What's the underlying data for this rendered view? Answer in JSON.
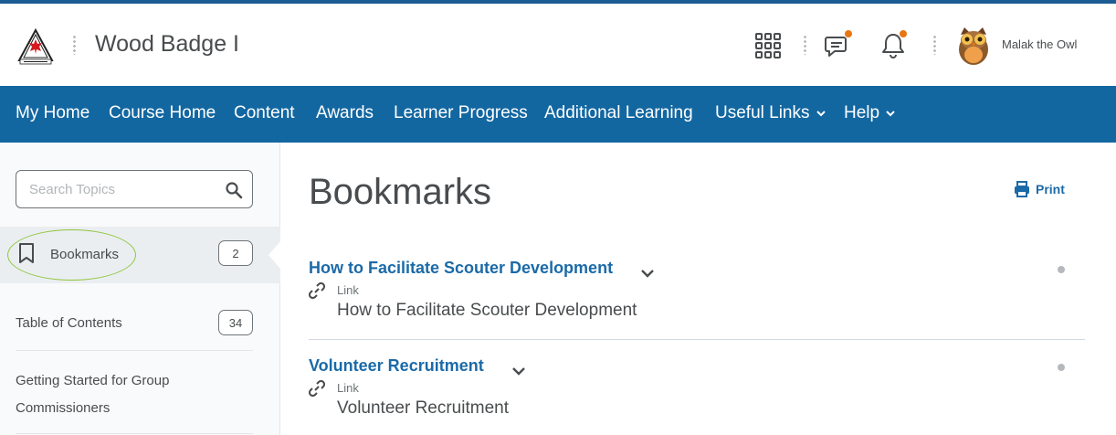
{
  "header": {
    "logo_name": "scouts-canada-logo",
    "course_title": "Wood Badge I",
    "user_name": "Malak the Owl",
    "accent_color": "#1367a1",
    "notification_color": "#e87511"
  },
  "nav": {
    "items": [
      {
        "label": "My Home"
      },
      {
        "label": "Course Home"
      },
      {
        "label": "Content"
      },
      {
        "label": "Awards"
      },
      {
        "label": "Learner Progress"
      },
      {
        "label": "Additional Learning"
      },
      {
        "label": "Useful Links",
        "dropdown": true
      },
      {
        "label": "Help",
        "dropdown": true
      }
    ]
  },
  "sidebar": {
    "search_placeholder": "Search Topics",
    "bookmarks": {
      "label": "Bookmarks",
      "count": "2"
    },
    "toc": {
      "label": "Table of Contents",
      "count": "34"
    },
    "module": {
      "label": "Getting Started for Group Commissioners"
    }
  },
  "main": {
    "title": "Bookmarks",
    "print_label": "Print",
    "topics": [
      {
        "title": "How to Facilitate Scouter Development",
        "type": "Link",
        "subtitle": "How to Facilitate Scouter Development"
      },
      {
        "title": "Volunteer Recruitment",
        "type": "Link",
        "subtitle": "Volunteer Recruitment"
      }
    ]
  }
}
